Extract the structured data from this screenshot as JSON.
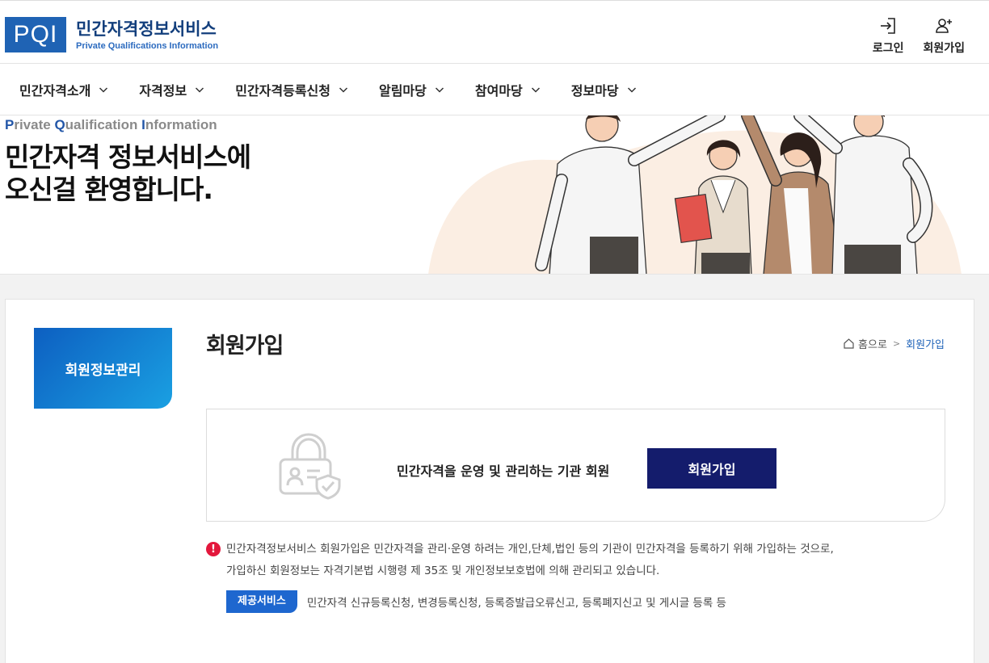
{
  "header": {
    "logo_mark": "PQI",
    "logo_title": "민간자격정보서비스",
    "logo_subtitle": "Private Qualifications Information",
    "util": [
      {
        "label": "로그인",
        "icon": "login-icon"
      },
      {
        "label": "회원가입",
        "icon": "user-add-icon"
      }
    ]
  },
  "gnb": {
    "items": [
      {
        "label": "민간자격소개"
      },
      {
        "label": "자격정보"
      },
      {
        "label": "민간자격등록신청"
      },
      {
        "label": "알림마당"
      },
      {
        "label": "참여마당"
      },
      {
        "label": "정보마당"
      }
    ]
  },
  "hero": {
    "en_p": "P",
    "en_rivate": "rivate ",
    "en_q": "Q",
    "en_ualification": "ualification ",
    "en_i": "I",
    "en_nformation": "nformation",
    "title_line1": "민간자격 정보서비스에",
    "title_line2": "오신걸 환영합니다."
  },
  "sidebar": {
    "menu_label": "회원정보관리"
  },
  "content": {
    "page_title": "회원가입",
    "breadcrumb": {
      "home": "홈으로",
      "separator": ">",
      "current": "회원가입"
    },
    "join_box": {
      "icon": "lock-id-icon",
      "description": "민간자격을 운영 및 관리하는 기관 회원",
      "button_label": "회원가입"
    },
    "notice": {
      "icon_glyph": "!",
      "line1": "민간자격정보서비스 회원가입은 민간자격을 관리·운영 하려는 개인,단체,법인 등의 기관이 민간자격을 등록하기 위해 가입하는 것으로,",
      "line2": "가입하신 회원정보는 자격기본법 시행령 제 35조 및 개인정보보호법에 의해 관리되고 있습니다.",
      "service_badge": "제공서비스",
      "service_text": "민간자격 신규등록신청, 변경등록신청, 등록증발급오류신고, 등록폐지신고 및 게시글 등록 등"
    }
  },
  "colors": {
    "brand_blue": "#1f63b4",
    "navy_button": "#141c6c",
    "side_gradient_start": "#0d5fc1",
    "side_gradient_end": "#1aa0e2",
    "notice_red": "#e3173c",
    "badge_blue": "#1e67cf"
  }
}
